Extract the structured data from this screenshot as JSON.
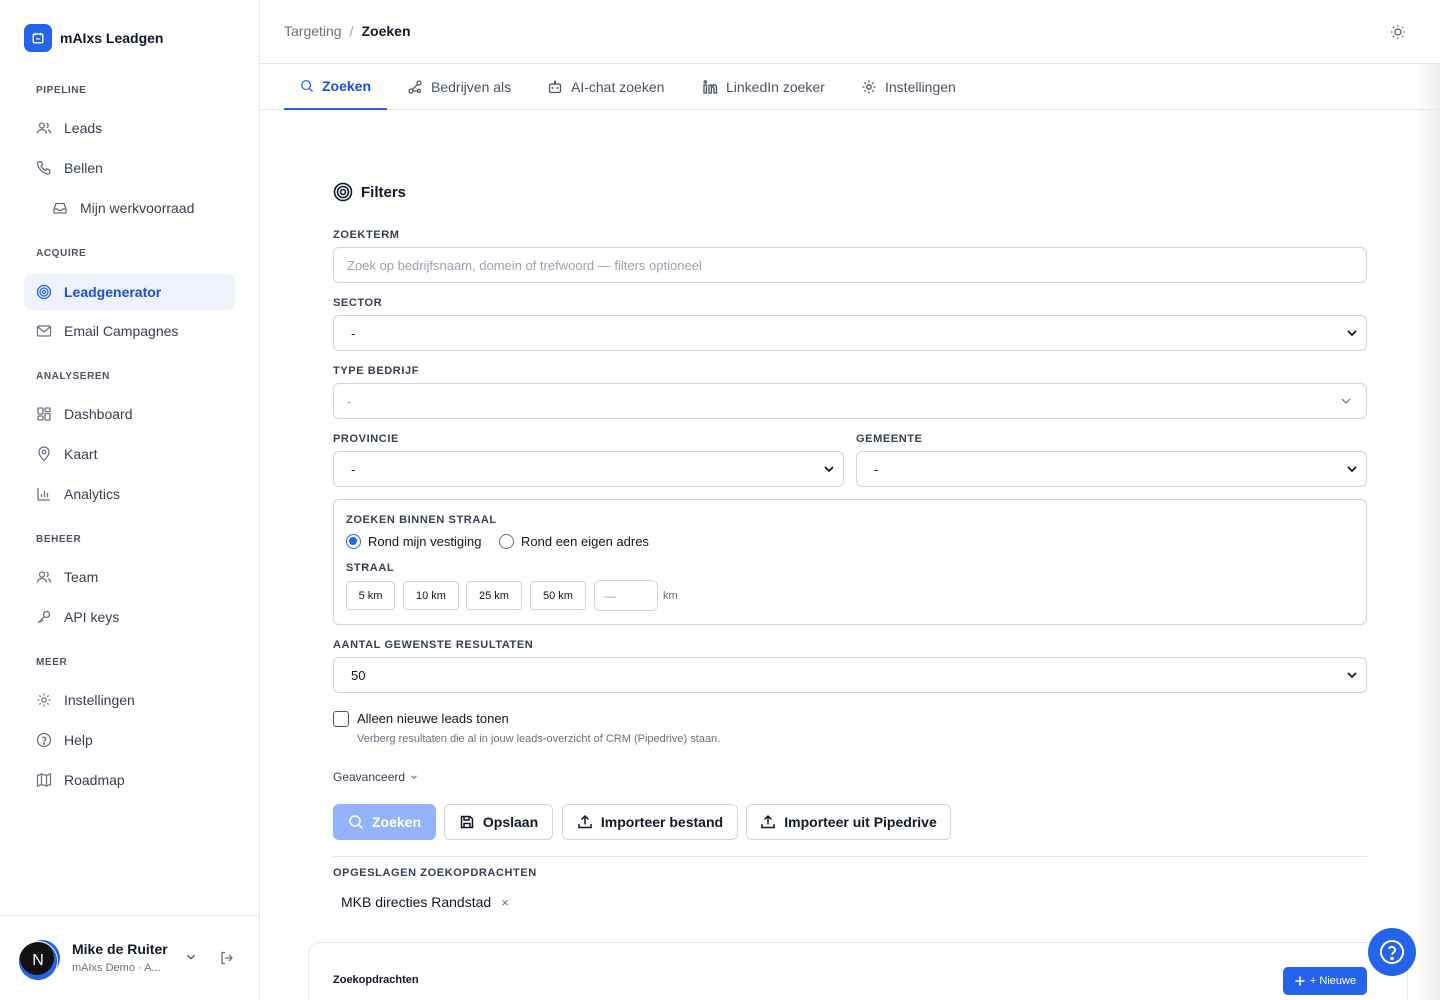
{
  "app": {
    "brand_name": "mAIxs Leadgen"
  },
  "sidebar": {
    "sections": {
      "pipeline": "PIPELINE",
      "acquire": "ACQUIRE",
      "analyseren": "ANALYSEREN",
      "beheer": "BEHEER",
      "meer": "MEER"
    },
    "items": {
      "leads": "Leads",
      "bellen": "Bellen",
      "werkvoorraad": "Mijn werkvoorraad",
      "leadgenerator": "Leadgenerator",
      "email": "Email Campagnes",
      "dashboard": "Dashboard",
      "kaart": "Kaart",
      "analytics": "Analytics",
      "team": "Team",
      "api_keys": "API keys",
      "instellingen": "Instellingen",
      "help": "Help",
      "roadmap": "Roadmap"
    },
    "user": {
      "initial": "N",
      "name": "Mike de Ruiter",
      "org": "mAIxs Demo · A..."
    }
  },
  "header": {
    "breadcrumb_parent": "Targeting",
    "breadcrumb_sep": "/",
    "breadcrumb_current": "Zoeken"
  },
  "tabs": {
    "zoeken": "Zoeken",
    "bedrijven_als": "Bedrijven als",
    "ai_chat": "AI-chat zoeken",
    "linkedin": "LinkedIn zoeker",
    "instellingen": "Instellingen"
  },
  "filters": {
    "title": "Filters",
    "zoekterm_label": "ZOEKTERM",
    "zoekterm_placeholder": "Zoek op bedrijfsnaam, domein of trefwoord — filters optioneel",
    "sector_label": "SECTOR",
    "sector_value": "-",
    "type_label": "TYPE BEDRIJF",
    "type_value": "-",
    "provincie_label": "PROVINCIE",
    "provincie_value": "-",
    "gemeente_label": "GEMEENTE",
    "gemeente_value": "-",
    "radius_label": "ZOEKEN BINNEN STRAAL",
    "radio_vestiging": "Rond mijn vestiging",
    "radio_adres": "Rond een eigen adres",
    "straal_label": "STRAAL",
    "km_options": [
      "5 km",
      "10 km",
      "25 km",
      "50 km"
    ],
    "km_custom_placeholder": "—",
    "km_unit": "km",
    "results_label": "AANTAL GEWENSTE RESULTATEN",
    "results_value": "50",
    "new_only_label": "Alleen nieuwe leads tonen",
    "new_only_hint": "Verberg resultaten die al in jouw leads-overzicht of CRM (Pipedrive) staan.",
    "advanced": "Geavanceerd"
  },
  "actions": {
    "zoeken": "Zoeken",
    "opslaan": "Opslaan",
    "import_file": "Importeer bestand",
    "import_pipedrive": "Importeer uit Pipedrive"
  },
  "saved": {
    "label": "OPGESLAGEN ZOEKOPDRACHTEN",
    "items": [
      "MKB directies Randstad"
    ],
    "remove_glyph": "×"
  },
  "card": {
    "title": "Zoekopdrachten",
    "new_button": "+ Nieuwe"
  },
  "colors": {
    "accent": "#2563eb",
    "accent_soft": "#93b4fb",
    "active_bg": "#eef2fb"
  }
}
